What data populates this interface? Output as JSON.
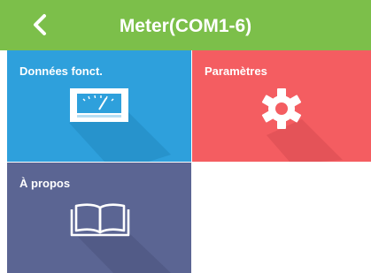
{
  "header": {
    "title": "Meter(COM1-6)",
    "background_color": "#7cbf4a",
    "back_icon": "chevron-left-icon"
  },
  "tiles": [
    {
      "label": "Données fonct.",
      "icon": "meter-gauge-icon",
      "color": "#2ea0dc"
    },
    {
      "label": "Paramètres",
      "icon": "gear-icon",
      "color": "#f45d61"
    },
    {
      "label": "À propos",
      "icon": "open-book-icon",
      "color": "#5b6593"
    }
  ]
}
